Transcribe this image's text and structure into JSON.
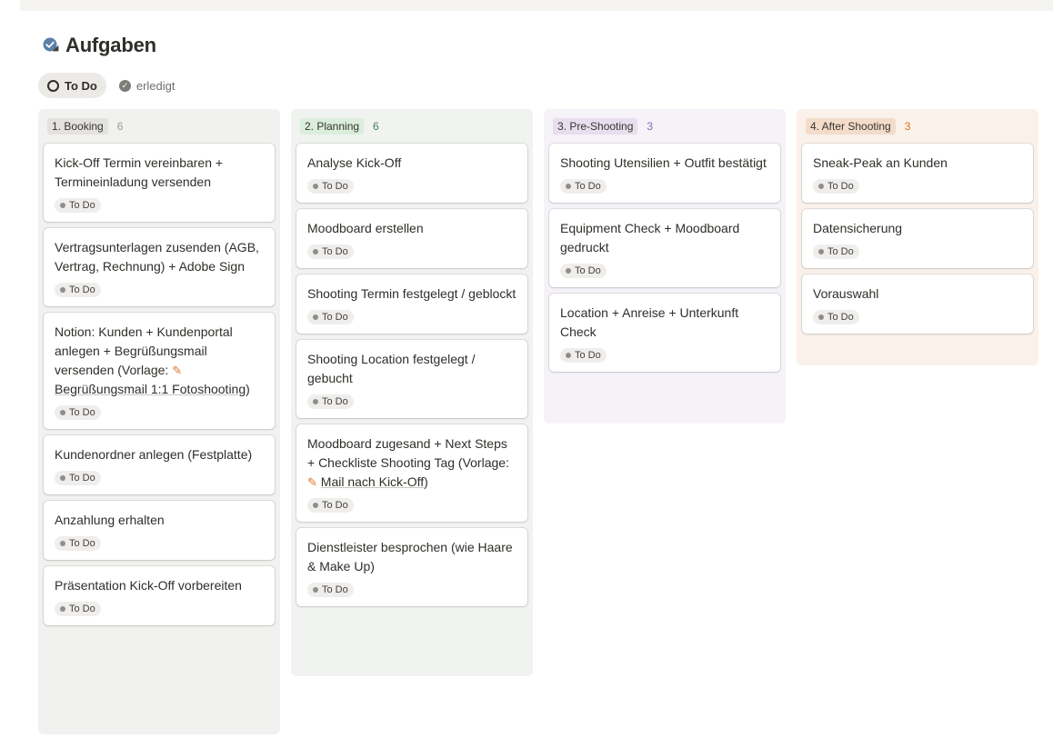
{
  "header": {
    "icon": "checklist-icon",
    "title": "Aufgaben"
  },
  "views": [
    {
      "label": "To Do",
      "icon": "circle-icon",
      "active": true
    },
    {
      "label": "erledigt",
      "icon": "check-circle-icon",
      "active": false
    }
  ],
  "colors": {
    "booking": {
      "bg": "#f1f1ef",
      "label_bg": "#e3e2e0",
      "count": "#9b9a97"
    },
    "planning": {
      "bg": "#f0f3f0",
      "label_bg": "#dbeddb",
      "count": "#448361"
    },
    "pre_shooting": {
      "bg": "#f5f2f8",
      "label_bg": "#e8deee",
      "count": "#9065b0"
    },
    "after_shooting": {
      "bg": "#f9f1ea",
      "label_bg": "#f4dccb",
      "count": "#d9730d"
    }
  },
  "columns": [
    {
      "label": "1. Booking",
      "count": "6",
      "cards": [
        {
          "title": "Kick-Off Termin vereinbaren + Termineinladung versenden",
          "status": "To Do"
        },
        {
          "title": "Vertragsunterlagen zusenden (AGB, Vertrag, Rechnung) + Adobe Sign",
          "status": "To Do"
        },
        {
          "title_pre": "Notion: Kunden + Kundenportal anlegen + Begrüßungsmail versenden (Vorlage: ",
          "mention": "Begrüßungsmail 1:1 Fotoshooting",
          "title_post": ")",
          "status": "To Do"
        },
        {
          "title": "Kundenordner anlegen (Festplatte)",
          "status": "To Do"
        },
        {
          "title": "Anzahlung erhalten",
          "status": "To Do"
        },
        {
          "title": "Präsentation Kick-Off vorbereiten",
          "status": "To Do"
        }
      ]
    },
    {
      "label": "2. Planning",
      "count": "6",
      "cards": [
        {
          "title": "Analyse Kick-Off",
          "status": "To Do"
        },
        {
          "title": "Moodboard erstellen",
          "status": "To Do"
        },
        {
          "title": "Shooting Termin festgelegt / geblockt",
          "status": "To Do"
        },
        {
          "title": "Shooting Location festgelegt / gebucht",
          "status": "To Do"
        },
        {
          "title_pre": "Moodboard zugesand + Next Steps + Checkliste Shooting Tag (Vorlage: ",
          "mention": "Mail nach Kick-Off",
          "title_post": ")",
          "status": "To Do"
        },
        {
          "title": "Dienstleister besprochen (wie Haare & Make Up)",
          "status": "To Do"
        }
      ]
    },
    {
      "label": "3. Pre-Shooting",
      "count": "3",
      "cards": [
        {
          "title": "Shooting Utensilien + Outfit bestätigt",
          "status": "To Do"
        },
        {
          "title": "Equipment Check + Moodboard gedruckt",
          "status": "To Do"
        },
        {
          "title": "Location + Anreise + Unterkunft Check",
          "status": "To Do"
        }
      ]
    },
    {
      "label": "4. After Shooting",
      "count": "3",
      "cards": [
        {
          "title": "Sneak-Peak an Kunden",
          "status": "To Do"
        },
        {
          "title": "Datensicherung",
          "status": "To Do"
        },
        {
          "title": "Vorauswahl",
          "status": "To Do"
        }
      ]
    }
  ]
}
